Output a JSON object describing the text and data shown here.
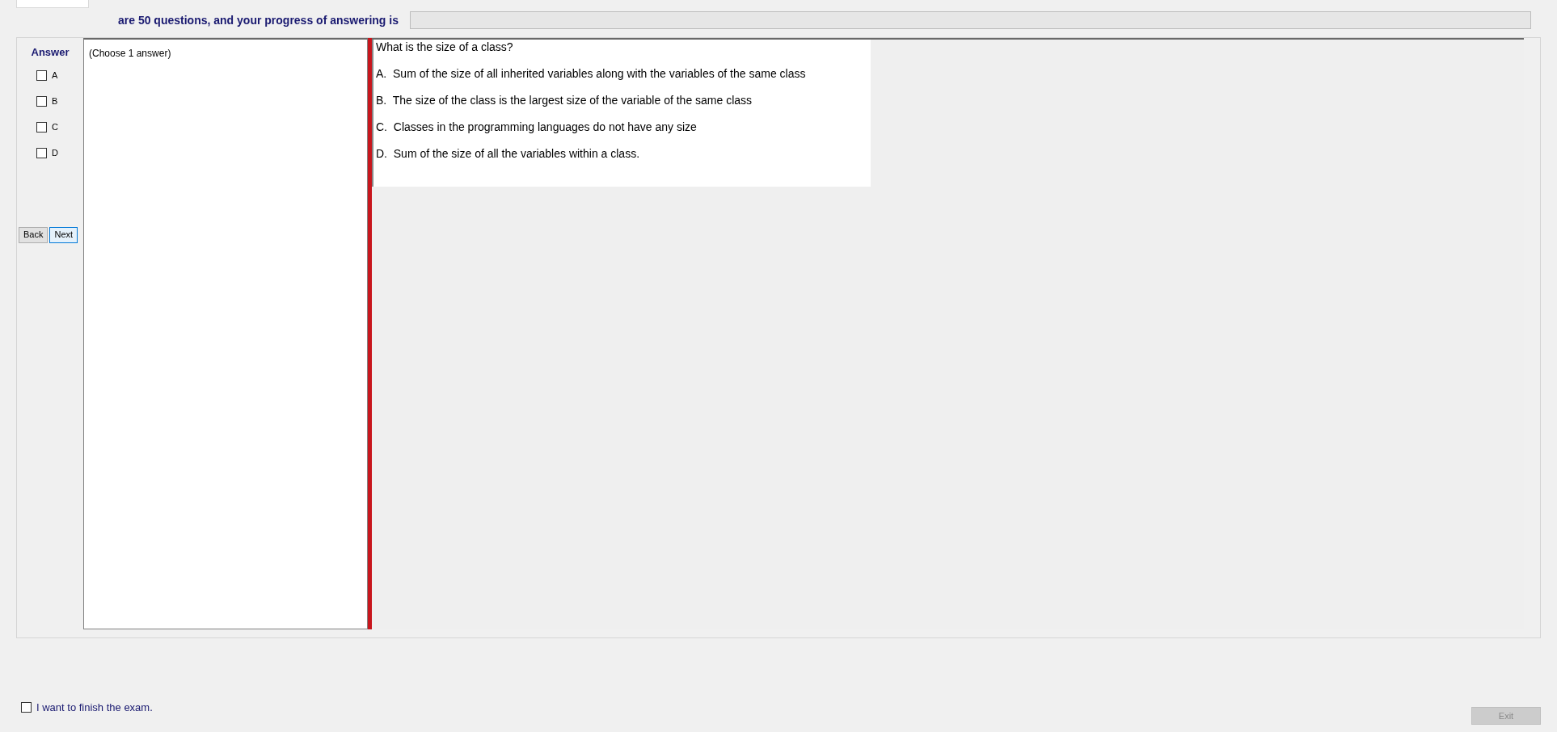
{
  "header": {
    "text": "are 50 questions, and your progress of answering is",
    "progress": {
      "level": 0
    }
  },
  "answer_panel": {
    "title": "Answer",
    "options": [
      {
        "label": "A",
        "checked": false
      },
      {
        "label": "B",
        "checked": false
      },
      {
        "label": "C",
        "checked": false
      },
      {
        "label": "D",
        "checked": false
      }
    ],
    "buttons": [
      {
        "label": "Back",
        "selected": false
      },
      {
        "label": "Next",
        "selected": true
      }
    ]
  },
  "instruction": "(Choose 1 answer)",
  "question": {
    "text": "What is the size of a class?",
    "choices": [
      "A.  Sum of the size of all inherited variables along with the variables of the same class",
      "B.  The size of the class is the largest size of the variable of the same class",
      "C.  Classes in the programming languages do not have any size",
      "D.  Sum of the size of all the variables within a class."
    ]
  },
  "finish": {
    "label": "I want to finish the exam.",
    "checked": false
  },
  "exit_button": {
    "label": "Exit",
    "disabled": true
  }
}
